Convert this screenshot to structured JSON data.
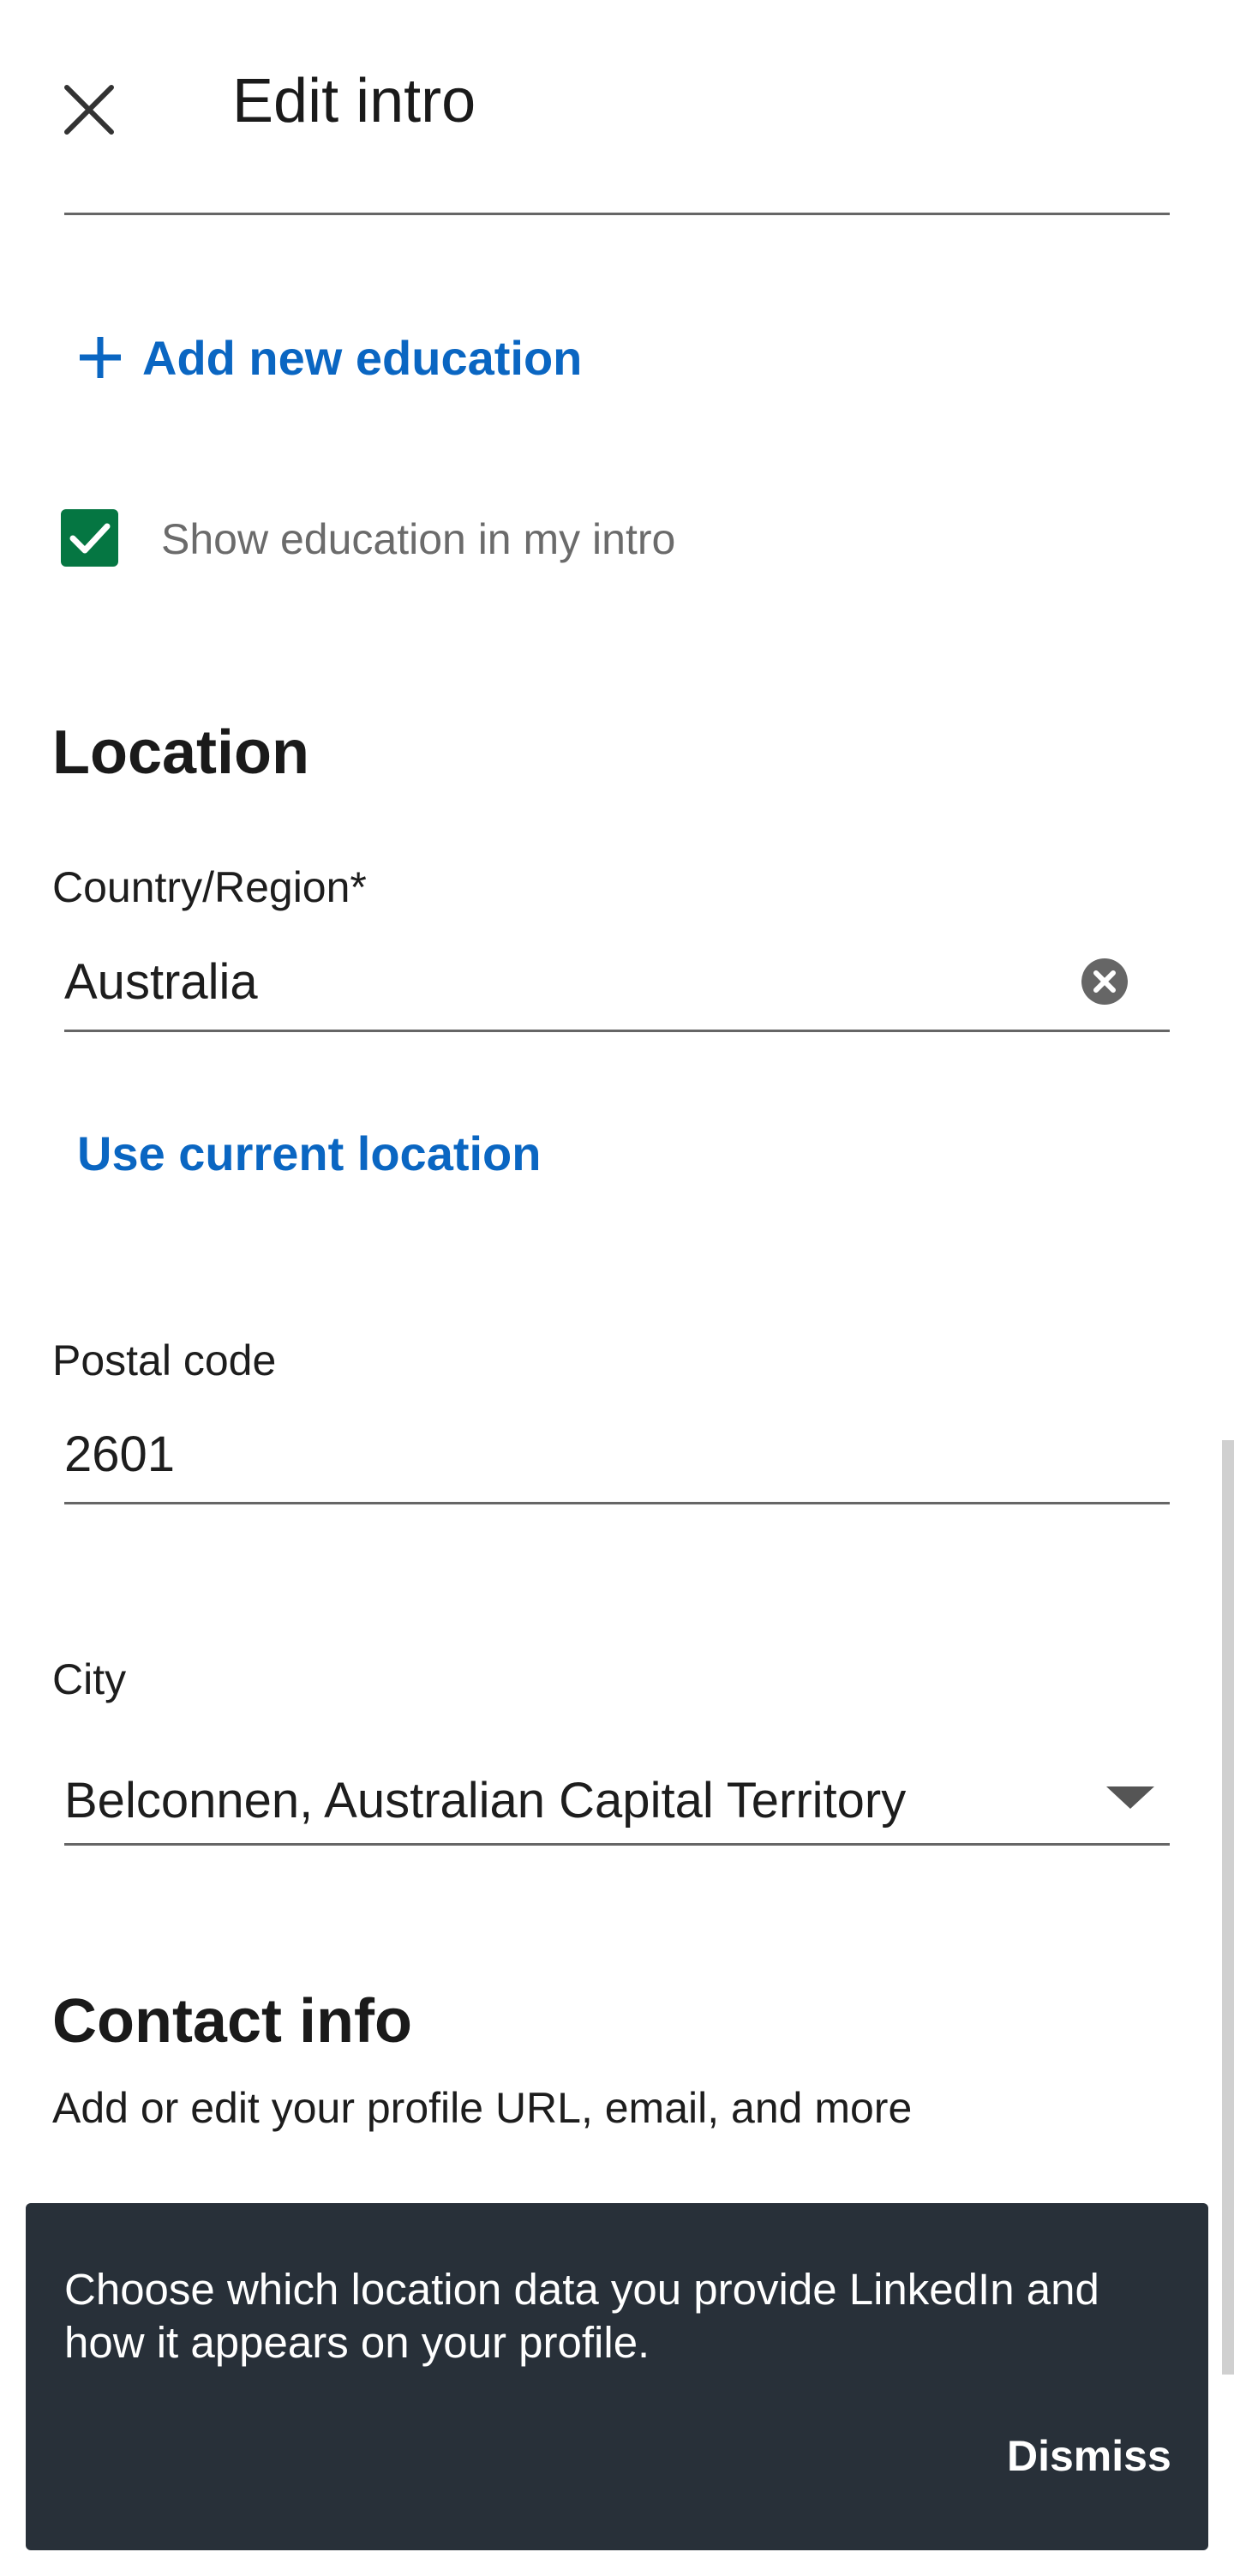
{
  "header": {
    "title": "Edit intro"
  },
  "education": {
    "add_label": "Add new education",
    "show_checkbox_label": "Show education in my intro",
    "show_checked": true
  },
  "location": {
    "heading": "Location",
    "country_label": "Country/Region*",
    "country_value": "Australia",
    "use_current_label": "Use current location",
    "postal_label": "Postal code",
    "postal_value": "2601",
    "city_label": "City",
    "city_value": "Belconnen, Australian Capital Territory"
  },
  "contact": {
    "heading": "Contact info",
    "subtitle": "Add or edit your profile URL, email, and more"
  },
  "toast": {
    "message": "Choose which location data you provide LinkedIn and how it appears on your profile.",
    "dismiss_label": "Dismiss"
  },
  "colors": {
    "link": "#0a66c2",
    "checkbox": "#057642",
    "toast_bg": "#283039"
  },
  "icons": [
    "close-icon",
    "plus-icon",
    "checkmark-icon",
    "clear-icon",
    "dropdown-arrow-icon"
  ]
}
